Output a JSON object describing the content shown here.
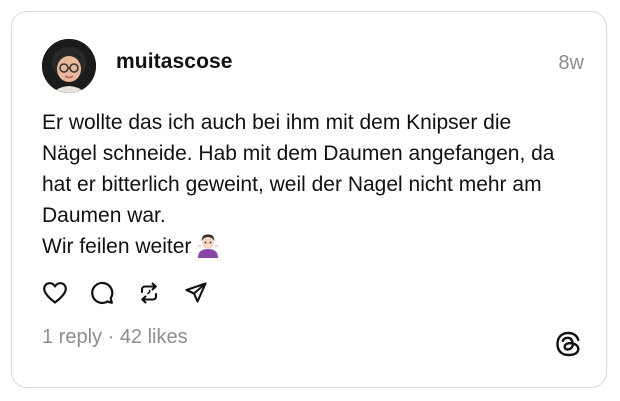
{
  "post": {
    "username": "muitascose",
    "timestamp": "8w",
    "text_lines": [
      "Er wollte das ich auch bei ihm mit dem Knipser die",
      "Nägel schneide. Hab mit dem Daumen angefangen, da",
      "hat er bitterlich geweint, weil der Nagel nicht mehr am",
      "Daumen war.",
      "Wir feilen weiter"
    ],
    "emoji": "person-shrugging-emoji"
  },
  "actions": {
    "like": "heart-icon",
    "reply": "comment-icon",
    "repost": "repost-icon",
    "share": "send-icon"
  },
  "stats": {
    "replies": "1 reply",
    "separator": " · ",
    "likes": "42 likes"
  },
  "colors": {
    "text": "#111111",
    "muted": "#8e8e8e",
    "border": "#d9d9d9"
  }
}
